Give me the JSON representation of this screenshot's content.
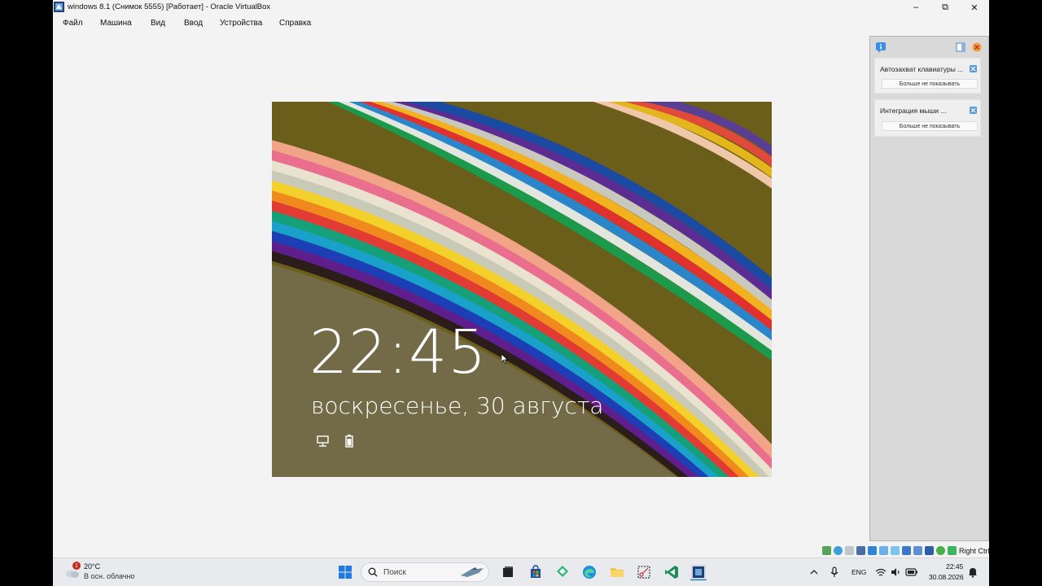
{
  "window": {
    "title": "windows 8.1 (Снимок 5555) [Работает] - Oracle VirtualBox",
    "controls": {
      "minimize": "–",
      "restore": "⧉",
      "close": "✕"
    }
  },
  "menu": [
    "Файл",
    "Машина",
    "Вид",
    "Ввод",
    "Устройства",
    "Справка"
  ],
  "vm": {
    "time": "22:45",
    "date": "воскресенье, 30 августа"
  },
  "notifications": [
    {
      "title": "Автозахват клавиатуры ...",
      "button": "Больше не показывать"
    },
    {
      "title": "Интеграция мыши ...",
      "button": "Больше не показывать"
    }
  ],
  "statusbar": {
    "host_key": "Right Ctrl"
  },
  "taskbar": {
    "weather": {
      "temp": "20°C",
      "desc": "В осн. облачно",
      "badge": "1"
    },
    "search_placeholder": "Поиск",
    "lang": "ENG",
    "clock_time": "22:45",
    "clock_date": "30.08.2026"
  },
  "colors": {
    "frame_bg": "#f3f3f3",
    "panel_bg": "#d9d9d9",
    "taskbar_bg": "#e8eaed",
    "accent": "#0067c0"
  }
}
